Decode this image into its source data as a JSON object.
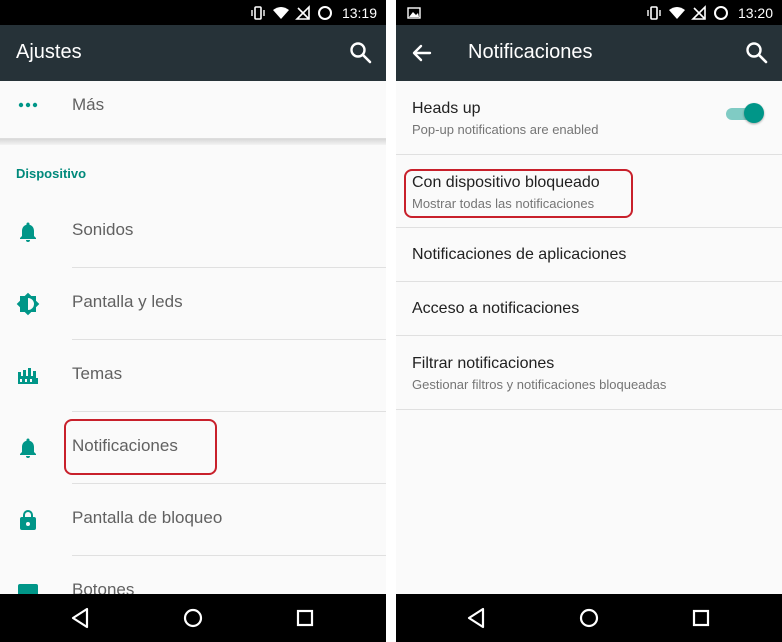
{
  "left": {
    "status_time": "13:19",
    "toolbar_title": "Ajustes",
    "more_label": "Más",
    "section_header": "Dispositivo",
    "items": [
      {
        "label": "Sonidos",
        "icon": "bell-icon"
      },
      {
        "label": "Pantalla y leds",
        "icon": "brightness-icon"
      },
      {
        "label": "Temas",
        "icon": "themes-icon"
      },
      {
        "label": "Notificaciones",
        "icon": "bell-icon"
      },
      {
        "label": "Pantalla de bloqueo",
        "icon": "lock-icon"
      },
      {
        "label": "Botones",
        "icon": "keyboard-icon"
      }
    ]
  },
  "right": {
    "status_time": "13:20",
    "toolbar_title": "Notificaciones",
    "prefs": [
      {
        "title": "Heads up",
        "summary": "Pop-up notifications are enabled",
        "toggle_on": true
      },
      {
        "title": "Con dispositivo bloqueado",
        "summary": "Mostrar todas las notificaciones"
      },
      {
        "title": "Notificaciones de aplicaciones"
      },
      {
        "title": "Acceso a notificaciones"
      },
      {
        "title": "Filtrar notificaciones",
        "summary": "Gestionar filtros y notificaciones bloqueadas"
      }
    ]
  },
  "colors": {
    "toolbar": "#263238",
    "accent": "#009688",
    "highlight": "#c8202b"
  }
}
